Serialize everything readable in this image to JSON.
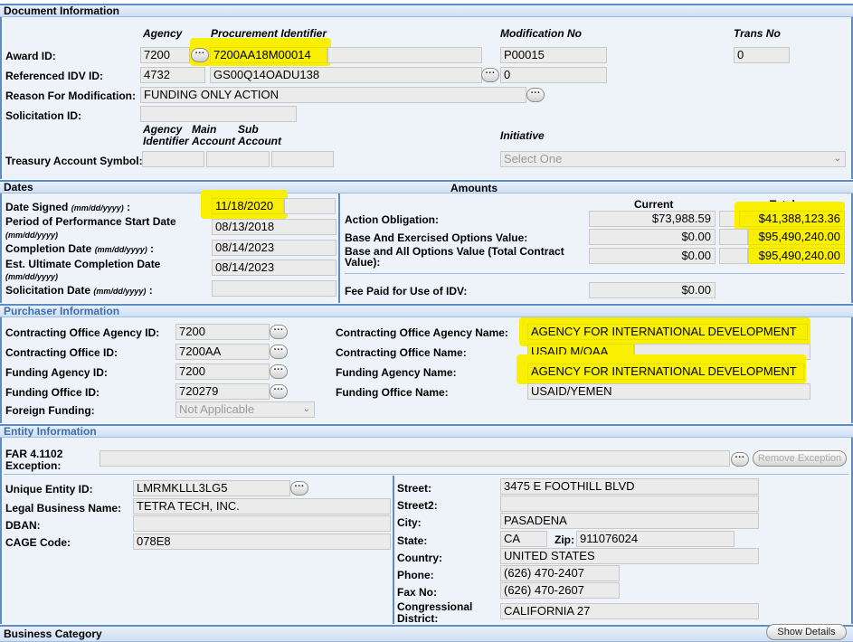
{
  "document_info": {
    "section_title": "Document Information",
    "col_agency": "Agency",
    "col_procurement": "Procurement Identifier",
    "col_modification": "Modification No",
    "col_trans": "Trans No",
    "award_id_label": "Award ID:",
    "award_agency": "7200",
    "award_procurement": "7200AA18M00014",
    "award_modification": "P00015",
    "award_trans": "0",
    "ref_idv_label": "Referenced IDV ID:",
    "ref_agency": "4732",
    "ref_procurement": "GS00Q14OADU138",
    "ref_modification": "0",
    "reason_label": "Reason For Modification:",
    "reason_value": "FUNDING ONLY ACTION",
    "solicitation_label": "Solicitation ID:",
    "solicitation_value": "",
    "col_agency_identifier": "Agency Identifier",
    "col_main_account": "Main Account",
    "col_sub_account": "Sub Account",
    "col_initiative": "Initiative",
    "treasury_label": "Treasury Account Symbol:",
    "initiative_value": "Select One"
  },
  "dates": {
    "section_title": "Dates",
    "date_signed_label": "Date Signed",
    "date_hint": "(mm/dd/yyyy)",
    "date_signed_value": "11/18/2020",
    "pop_start_label": "Period of Performance Start Date",
    "pop_start_value": "08/13/2018",
    "completion_label": "Completion Date",
    "completion_value": "08/14/2023",
    "est_completion_label": "Est. Ultimate Completion Date",
    "est_completion_value": "08/14/2023",
    "solicitation_date_label": "Solicitation Date"
  },
  "amounts": {
    "section_title": "Amounts",
    "col_current": "Current",
    "col_total": "Total",
    "action_obligation_label": "Action Obligation:",
    "action_obligation_current": "$73,988.59",
    "action_obligation_total": "$41,388,123.36",
    "base_exercised_label": "Base And Exercised Options Value:",
    "base_exercised_current": "$0.00",
    "base_exercised_total": "$95,490,240.00",
    "base_all_label": "Base and All Options Value (Total Contract Value):",
    "base_all_current": "$0.00",
    "base_all_total": "$95,490,240.00",
    "fee_label": "Fee Paid for Use of IDV:",
    "fee_value": "$0.00"
  },
  "purchaser": {
    "section_title": "Purchaser Information",
    "co_agency_id_label": "Contracting Office Agency ID:",
    "co_agency_id": "7200",
    "co_id_label": "Contracting Office ID:",
    "co_id": "7200AA",
    "funding_agency_id_label": "Funding Agency ID:",
    "funding_agency_id": "7200",
    "funding_office_id_label": "Funding Office ID:",
    "funding_office_id": "720279",
    "foreign_funding_label": "Foreign Funding:",
    "foreign_funding_value": "Not Applicable",
    "co_agency_name_label": "Contracting Office Agency Name:",
    "co_agency_name": "AGENCY FOR INTERNATIONAL DEVELOPMENT",
    "co_name_label": "Contracting Office Name:",
    "co_name": "USAID M/OAA",
    "funding_agency_name_label": "Funding Agency Name:",
    "funding_agency_name": "AGENCY FOR INTERNATIONAL DEVELOPMENT",
    "funding_office_name_label": "Funding Office Name:",
    "funding_office_name": "USAID/YEMEN"
  },
  "entity": {
    "section_title": "Entity Information",
    "far_label_1": "FAR 4.1102",
    "far_label_2": "Exception:",
    "remove_exception": "Remove Exception",
    "uei_label": "Unique Entity ID:",
    "uei": "LMRMKLLL3LG5",
    "legal_name_label": "Legal Business Name:",
    "legal_name": "TETRA TECH, INC.",
    "dban_label": "DBAN:",
    "dban": "",
    "cage_label": "CAGE Code:",
    "cage": "078E8",
    "street_label": "Street:",
    "street": "3475 E FOOTHILL BLVD",
    "street2_label": "Street2:",
    "street2": "",
    "city_label": "City:",
    "city": "PASADENA",
    "state_label": "State:",
    "state": "CA",
    "zip_label": "Zip:",
    "zip": "911076024",
    "country_label": "Country:",
    "country": "UNITED STATES",
    "phone_label": "Phone:",
    "phone": "(626) 470-2407",
    "fax_label": "Fax No:",
    "fax": "(626) 470-2607",
    "district_label_1": "Congressional",
    "district_label_2": "District:",
    "district": "CALIFORNIA 27"
  },
  "business": {
    "section_title": "Business Category",
    "show_details": "Show Details"
  },
  "colors": {
    "highlight": "#f8f000",
    "section_border": "#5b8cc8",
    "section_text_blue": "#3e6ea8"
  }
}
